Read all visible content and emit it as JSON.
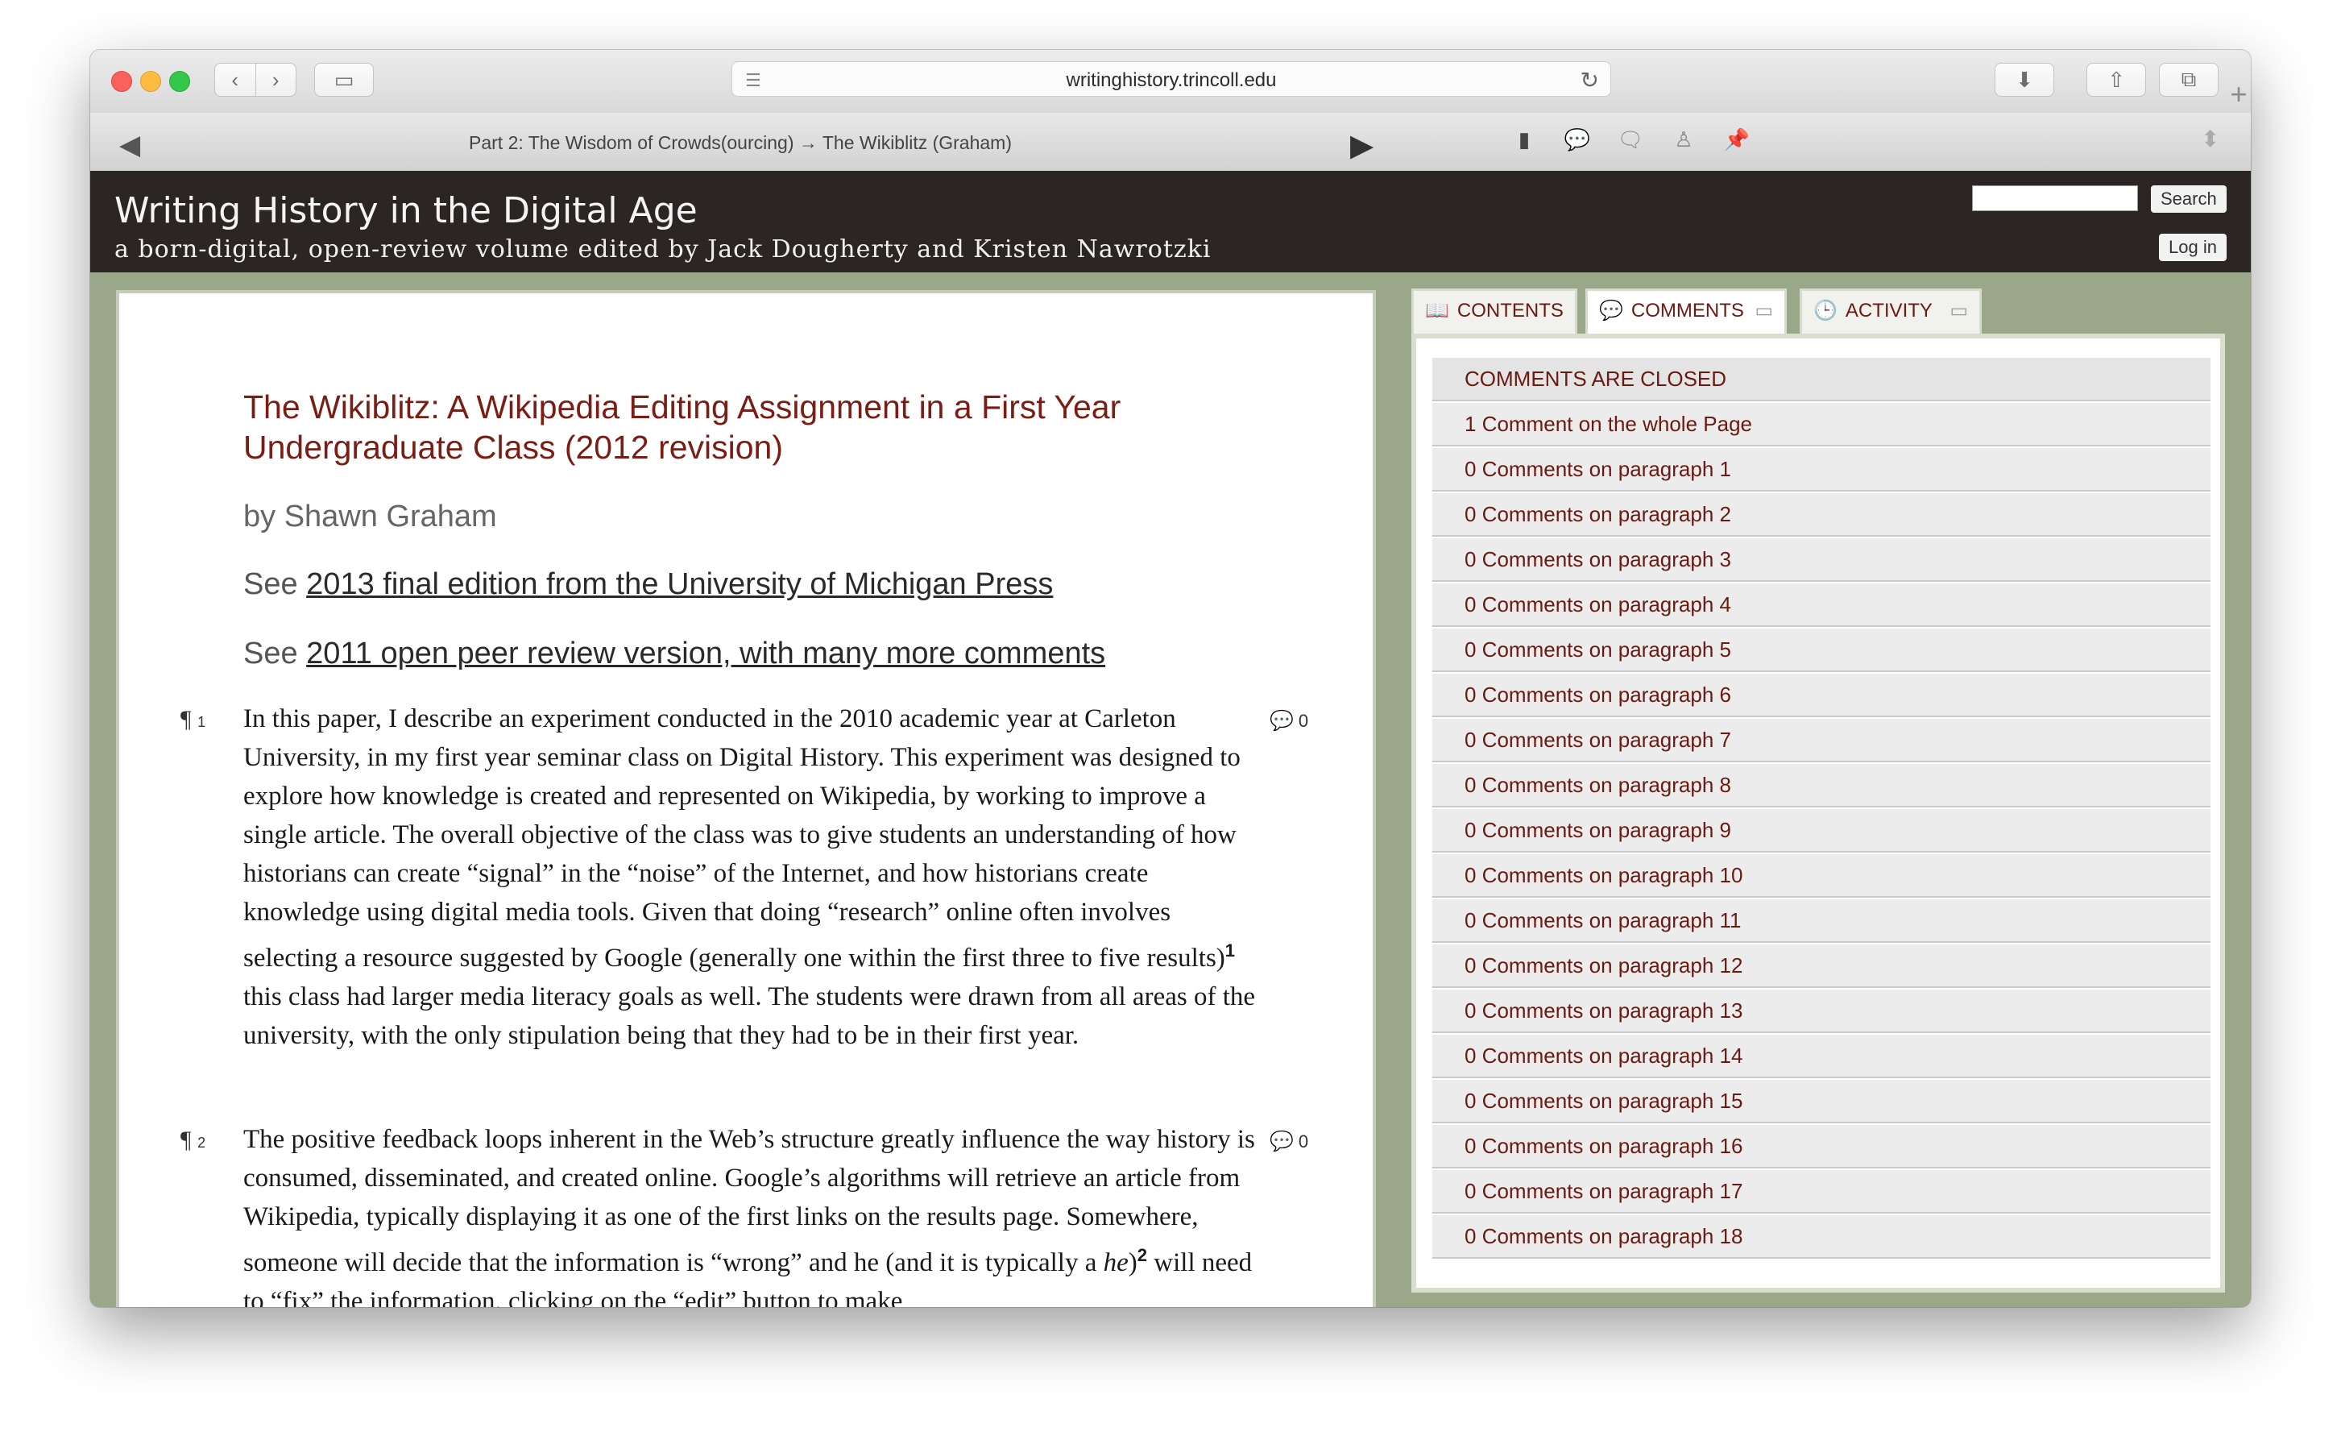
{
  "browser": {
    "url": "writinghistory.trincoll.edu",
    "back_icon": "chevron-left-icon",
    "forward_icon": "chevron-right-icon"
  },
  "cpnav": {
    "breadcrumb": "Part 2: The Wisdom of Crowds(ourcing) → The Wikiblitz (Graham)"
  },
  "header": {
    "title": "Writing History in the Digital Age",
    "subtitle": "a born-digital, open-review volume edited by Jack Dougherty and Kristen Nawrotzki",
    "search_label": "Search",
    "login_label": "Log in"
  },
  "article": {
    "title": "The Wikiblitz: A Wikipedia Editing Assignment in a First Year Undergraduate Class (2012 revision)",
    "byline": "by Shawn Graham",
    "see1_prefix": "See ",
    "see1_link": "2013 final edition from the University of Michigan Press",
    "see2_prefix": "See ",
    "see2_link": "2011 open peer review version, with many more comments",
    "paragraphs": [
      {
        "num": "1",
        "count": "0",
        "text_a": "In this paper, I describe an experiment conducted in the 2010 academic year at Carleton University, in my first year seminar class on Digital History. This experiment was designed to explore how knowledge is created and represented on Wikipedia, by working to improve a single article. The overall objective of the class was to give students an understanding of how historians can create “signal” in the “noise” of the Internet, and how historians create knowledge using digital media tools. Given that doing “research” online often involves selecting a resource suggested by Google (generally one within the first three to five results)",
        "footnote": "1",
        "text_b": " this class had larger media literacy goals as well. The students were drawn from all areas of the university, with the only stipulation being that they had to be in their first year."
      },
      {
        "num": "2",
        "count": "0",
        "text_a": "The positive feedback loops inherent in the Web’s structure greatly influence the way history is consumed, disseminated, and created online. Google’s algorithms will retrieve an article from Wikipedia, typically displaying it as one of the first links on the results page. Somewhere, someone will decide that the information is “wrong” and he (and it is typically a ",
        "em": "he",
        "text_b": ")",
        "footnote": "2",
        "text_c": " will need to “fix” the information, clicking on the “edit” button to make"
      }
    ]
  },
  "sidebar": {
    "tabs": [
      "CONTENTS",
      "COMMENTS",
      "ACTIVITY"
    ],
    "closed_label": "COMMENTS ARE CLOSED",
    "rows": [
      "1 Comment on the whole Page",
      "0 Comments on paragraph 1",
      "0 Comments on paragraph 2",
      "0 Comments on paragraph 3",
      "0 Comments on paragraph 4",
      "0 Comments on paragraph 5",
      "0 Comments on paragraph 6",
      "0 Comments on paragraph 7",
      "0 Comments on paragraph 8",
      "0 Comments on paragraph 9",
      "0 Comments on paragraph 10",
      "0 Comments on paragraph 11",
      "0 Comments on paragraph 12",
      "0 Comments on paragraph 13",
      "0 Comments on paragraph 14",
      "0 Comments on paragraph 15",
      "0 Comments on paragraph 16",
      "0 Comments on paragraph 17",
      "0 Comments on paragraph 18"
    ]
  },
  "colors": {
    "header_bg": "#2b2524",
    "accent_maroon": "#7a1d14",
    "frame_green": "#9aa789"
  }
}
